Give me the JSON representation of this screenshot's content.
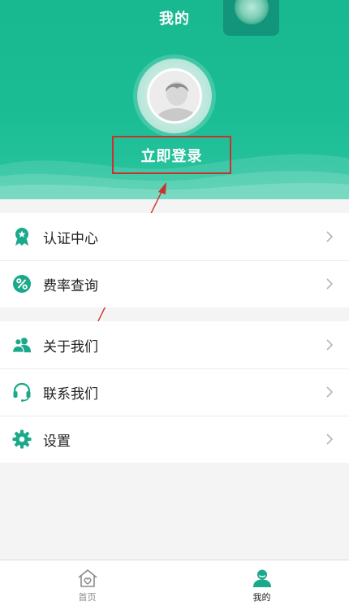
{
  "header": {
    "title": "我的"
  },
  "profile": {
    "login_label": "立即登录"
  },
  "menu": {
    "group1": [
      {
        "label": "认证中心",
        "icon": "badge-icon"
      },
      {
        "label": "费率查询",
        "icon": "percent-icon"
      }
    ],
    "group2": [
      {
        "label": "关于我们",
        "icon": "users-icon"
      },
      {
        "label": "联系我们",
        "icon": "headset-icon"
      },
      {
        "label": "设置",
        "icon": "gear-icon"
      }
    ]
  },
  "tabbar": {
    "home_label": "首页",
    "me_label": "我的"
  },
  "colors": {
    "brand": "#1bbd95",
    "annotation": "#c9322f",
    "icon": "#1aa98a"
  }
}
